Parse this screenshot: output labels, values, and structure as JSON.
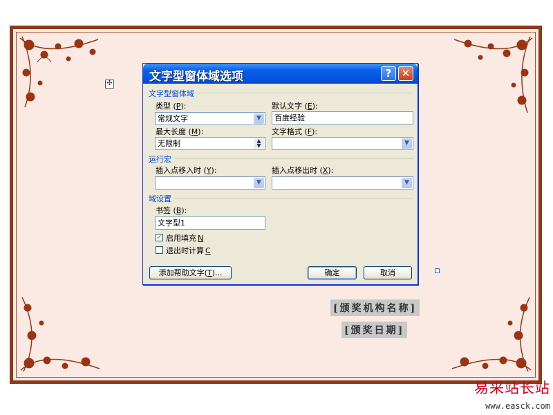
{
  "dialog": {
    "title": "文字型窗体域选项",
    "help_glyph": "?",
    "close_glyph": "✕",
    "section_text_field": "文字型窗体域",
    "type_label": "类型",
    "type_hotkey": "P",
    "type_value": "常规文字",
    "default_text_label": "默认文字",
    "default_text_hotkey": "E",
    "default_text_value": "百度经验",
    "max_length_label": "最大长度",
    "max_length_hotkey": "M",
    "max_length_value": "无限制",
    "text_format_label": "文字格式",
    "text_format_hotkey": "F",
    "text_format_value": "",
    "section_macro": "运行宏",
    "on_entry_label": "插入点移入时",
    "on_entry_hotkey": "Y",
    "on_entry_value": "",
    "on_exit_label": "插入点移出时",
    "on_exit_hotkey": "X",
    "on_exit_value": "",
    "section_field_settings": "域设置",
    "bookmark_label": "书签",
    "bookmark_hotkey": "B",
    "bookmark_value": "文字型1",
    "fill_in_label": "启用填充",
    "fill_in_hotkey": "N",
    "fill_in_checked": true,
    "calc_on_exit_label": "退出时计算",
    "calc_on_exit_hotkey": "C",
    "calc_on_exit_checked": false,
    "help_text_button": "添加帮助文字",
    "help_text_hotkey": "T",
    "ok_button": "确定",
    "cancel_button": "取消"
  },
  "certificate": {
    "award_org": "[颁奖机构名称]",
    "award_date": "[颁奖日期]",
    "frame_color": "#8b3a1a",
    "paper_color": "#fbeae4",
    "ornament_color": "#9b3412"
  },
  "watermark": {
    "cn": "易采站长站",
    "url": "www.easck.com"
  },
  "colors": {
    "titlebar": "#0a5fe6",
    "section_heading": "#0046d5",
    "dialog_face": "#ece9d8"
  }
}
